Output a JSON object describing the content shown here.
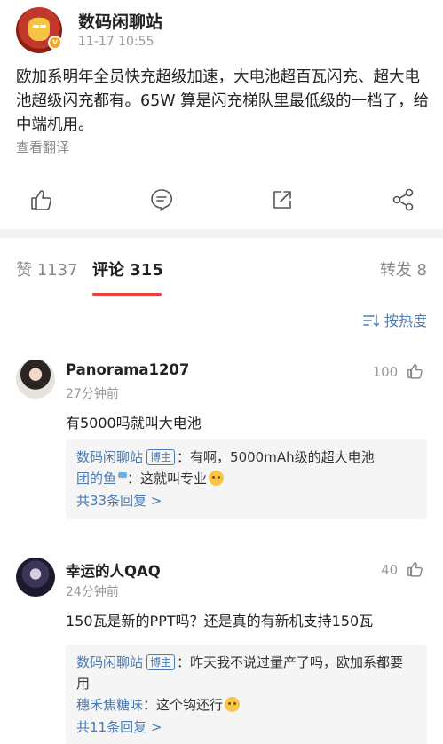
{
  "post": {
    "author": "数码闲聊站",
    "time": "11-17 10:55",
    "verified_mark": "v",
    "content": "欧加系明年全员快充超级加速，大电池超百瓦闪充、超大电池超级闪充都有。65W 算是闪充梯队里最低级的一档了，给中端机用。",
    "translate": "查看翻译"
  },
  "tabs": {
    "likes": "赞 1137",
    "comments": "评论 315",
    "reposts": "转发 8"
  },
  "sort": {
    "label": "按热度"
  },
  "comments": [
    {
      "name": "Panorama1207",
      "time": "27分钟前",
      "likes": "100",
      "text": "有5000吗就叫大电池",
      "replies": [
        {
          "name": "数码闲聊站",
          "tag": "博主",
          "text": "：有啊，5000mAh级的超大电池"
        },
        {
          "name": "团的鱼",
          "text": "：这就叫专业"
        }
      ],
      "more": "共33条回复 >"
    },
    {
      "name": "幸运的人QAQ",
      "time": "24分钟前",
      "likes": "40",
      "text": "150瓦是新的PPT吗？还是真的有新机支持150瓦",
      "replies": [
        {
          "name": "数码闲聊站",
          "tag": "博主",
          "text": "：昨天我不说过量产了吗，欧加系都要用"
        },
        {
          "name": "穗禾焦糖味",
          "text": "：这个钩还行"
        }
      ],
      "more": "共11条回复 >"
    }
  ],
  "icons": {
    "like": "thumbs-up-icon",
    "comment": "comment-icon",
    "repost": "repost-icon",
    "share": "share-icon",
    "sort": "sort-icon"
  },
  "colors": {
    "accent": "#e8403a",
    "link": "#4a7bb5",
    "muted": "#999999"
  }
}
